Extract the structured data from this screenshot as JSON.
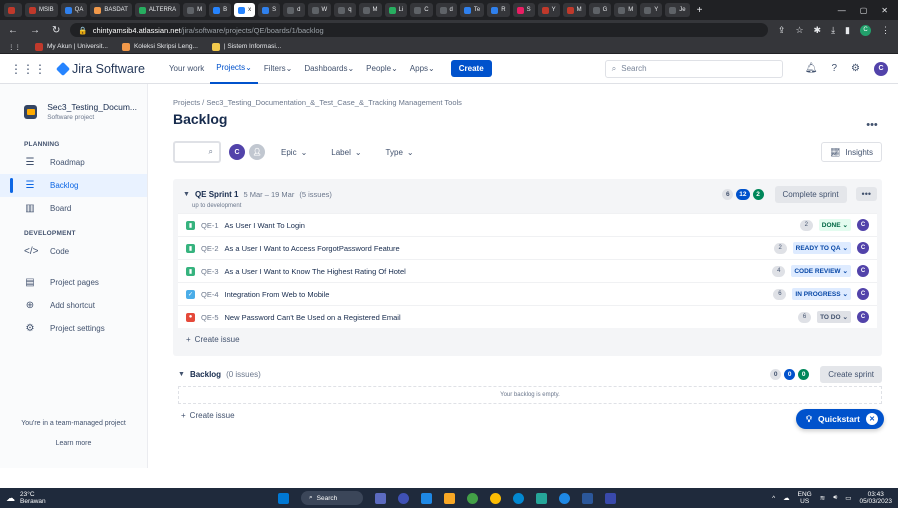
{
  "browser": {
    "tabs": [
      {
        "label": "",
        "color": "#c0392b"
      },
      {
        "label": "MSIB",
        "color": "#c0392b"
      },
      {
        "label": "QA",
        "color": "#2f80ed"
      },
      {
        "label": "BASDAT",
        "color": "#f2994a"
      },
      {
        "label": "ALTERRA",
        "color": "#27ae60"
      },
      {
        "label": "M",
        "color": "#5f6368"
      },
      {
        "label": "B",
        "color": "#2684ff"
      },
      {
        "label": "x",
        "color": "#2684ff",
        "active": true
      },
      {
        "label": "S",
        "color": "#2f80ed"
      },
      {
        "label": "d",
        "color": "#5f6368"
      },
      {
        "label": "W",
        "color": "#5f6368"
      },
      {
        "label": "q",
        "color": "#5f6368"
      },
      {
        "label": "M",
        "color": "#5f6368"
      },
      {
        "label": "Li",
        "color": "#27ae60"
      },
      {
        "label": "C",
        "color": "#5f6368"
      },
      {
        "label": "d",
        "color": "#5f6368"
      },
      {
        "label": "Te",
        "color": "#2f80ed"
      },
      {
        "label": "R",
        "color": "#2f80ed"
      },
      {
        "label": "S",
        "color": "#e91e63"
      },
      {
        "label": "Y",
        "color": "#c0392b"
      },
      {
        "label": "M",
        "color": "#c0392b"
      },
      {
        "label": "G",
        "color": "#5f6368"
      },
      {
        "label": "M",
        "color": "#5f6368"
      },
      {
        "label": "Y",
        "color": "#5f6368"
      },
      {
        "label": "Je",
        "color": "#5f6368"
      }
    ],
    "new_tab": "+",
    "url_host": "chintyamsib4.atlassian.net",
    "url_path": "/jira/software/projects/QE/boards/1/backlog",
    "bookmarks": [
      {
        "label": "My Akun | Universit...",
        "color": "#c0392b"
      },
      {
        "label": "Koleksi Skripsi Leng...",
        "color": "#f2994a"
      },
      {
        "label": "| Sistem Informasi...",
        "color": "#f2c94c"
      }
    ]
  },
  "jira": {
    "product": "Jira Software",
    "nav": [
      "Your work",
      "Projects",
      "Filters",
      "Dashboards",
      "People",
      "Apps"
    ],
    "create": "Create",
    "search_placeholder": "Search",
    "user_initial": "C"
  },
  "sidebar": {
    "project_name": "Sec3_Testing_Docum...",
    "project_type": "Software project",
    "planning_label": "PLANNING",
    "planning": [
      {
        "label": "Roadmap",
        "icon": "roadmap-icon"
      },
      {
        "label": "Backlog",
        "icon": "backlog-icon",
        "selected": true
      },
      {
        "label": "Board",
        "icon": "board-icon"
      }
    ],
    "development_label": "DEVELOPMENT",
    "development": [
      {
        "label": "Code",
        "icon": "code-icon"
      }
    ],
    "other": [
      {
        "label": "Project pages",
        "icon": "pages-icon"
      },
      {
        "label": "Add shortcut",
        "icon": "shortcut-icon"
      },
      {
        "label": "Project settings",
        "icon": "settings-icon"
      }
    ],
    "footer_text": "You're in a team-managed project",
    "learn_more": "Learn more"
  },
  "main": {
    "breadcrumb": "Projects / Sec3_Testing_Documentation_&_Test_Case_&_Tracking Management Tools",
    "title": "Backlog",
    "filters": {
      "epic": "Epic",
      "label": "Label",
      "type": "Type",
      "insights": "Insights"
    },
    "sprint": {
      "name": "QE Sprint 1",
      "dates": "5 Mar – 19 Mar",
      "count": "(5 issues)",
      "goal": "up to development",
      "todo": "6",
      "inprogress": "12",
      "done": "2",
      "complete": "Complete sprint",
      "issues": [
        {
          "key": "QE-1",
          "title": "As User I Want To Login",
          "type": "story",
          "points": "2",
          "status": "DONE",
          "status_bg": "#e3fcef",
          "status_fg": "#006644"
        },
        {
          "key": "QE-2",
          "title": "As a User I Want to Access ForgotPassword Feature",
          "type": "story",
          "points": "2",
          "status": "READY TO QA",
          "status_bg": "#deebff",
          "status_fg": "#0747a6"
        },
        {
          "key": "QE-3",
          "title": "As a User I Want to Know The Highest Rating Of Hotel",
          "type": "story",
          "points": "4",
          "status": "CODE REVIEW",
          "status_bg": "#deebff",
          "status_fg": "#0747a6"
        },
        {
          "key": "QE-4",
          "title": "Integration From Web to Mobile",
          "type": "task",
          "points": "6",
          "status": "IN PROGRESS",
          "status_bg": "#deebff",
          "status_fg": "#0747a6"
        },
        {
          "key": "QE-5",
          "title": "New Password Can't Be Used on a Registered Email",
          "type": "bug",
          "points": "6",
          "status": "TO DO",
          "status_bg": "#dfe1e6",
          "status_fg": "#42526e"
        }
      ],
      "create_issue": "Create issue"
    },
    "backlog": {
      "name": "Backlog",
      "count": "(0 issues)",
      "todo": "0",
      "inprogress": "0",
      "done": "0",
      "create_sprint": "Create sprint",
      "empty": "Your backlog is empty.",
      "create_issue": "Create issue"
    },
    "quickstart": "Quickstart"
  },
  "taskbar": {
    "temp": "23°C",
    "weather": "Berawan",
    "search": "Search",
    "lang": "ENG",
    "region": "US",
    "time": "03:43",
    "date": "05/03/2023"
  }
}
